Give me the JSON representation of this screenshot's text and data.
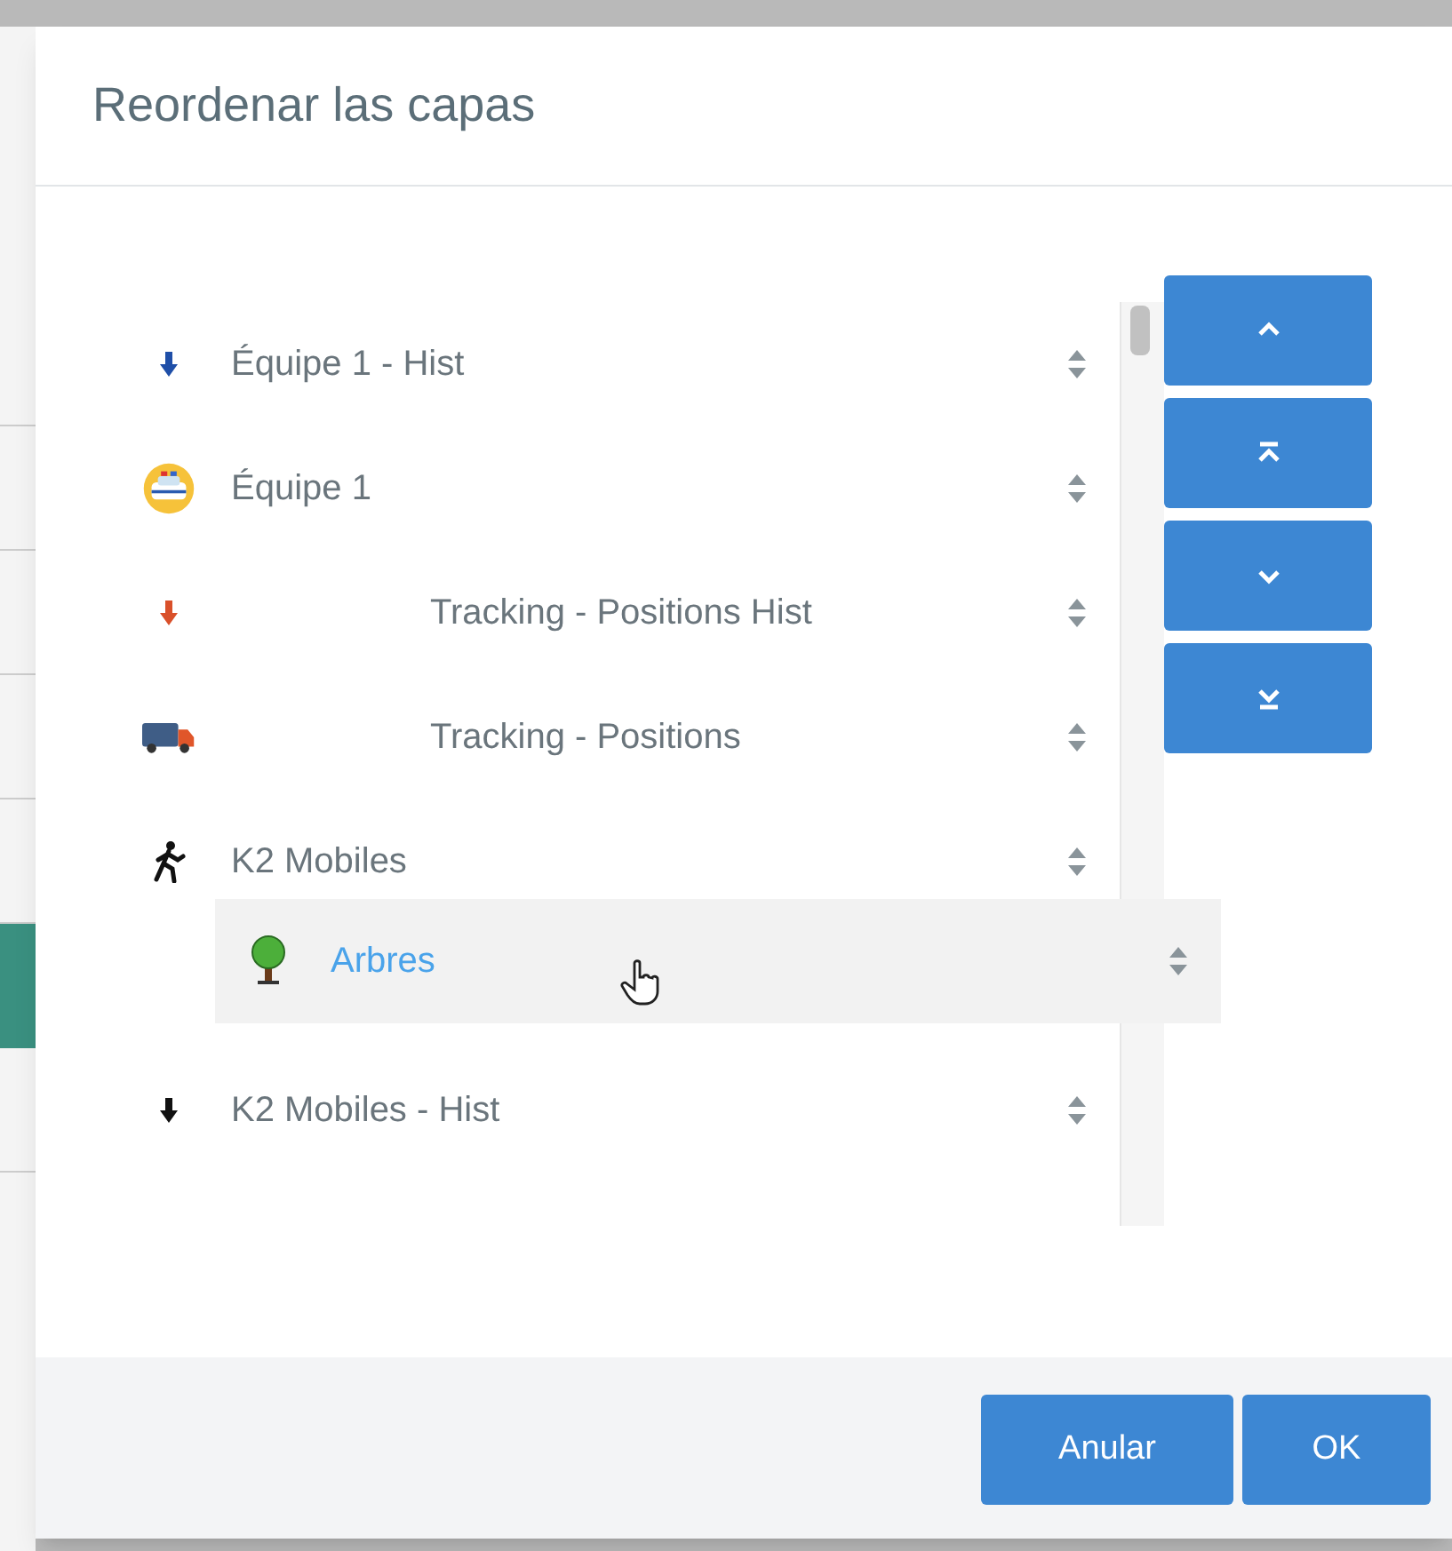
{
  "dialog": {
    "title": "Reordenar las capas"
  },
  "layers": [
    {
      "label": "Équipe 1 - Hist",
      "kind": "arrow",
      "color": "#1f4fa8",
      "text_indented": false,
      "dragging": false
    },
    {
      "label": "Équipe 1",
      "kind": "police-car",
      "text_indented": false,
      "dragging": false
    },
    {
      "label": "Tracking - Positions Hist",
      "kind": "arrow",
      "color": "#d9502a",
      "text_indented": true,
      "dragging": false
    },
    {
      "label": "Tracking - Positions",
      "kind": "truck",
      "text_indented": true,
      "dragging": false
    },
    {
      "label": "K2 Mobiles",
      "kind": "runner",
      "text_indented": false,
      "dragging": false
    },
    {
      "label": "Arbres",
      "kind": "tree",
      "text_indented": false,
      "dragging": true
    },
    {
      "label": "K2 Mobiles - Hist",
      "kind": "arrow",
      "color": "#111111",
      "text_indented": false,
      "dragging": false
    }
  ],
  "move_buttons": [
    {
      "kind": "up"
    },
    {
      "kind": "top"
    },
    {
      "kind": "down"
    },
    {
      "kind": "bottom"
    }
  ],
  "footer_buttons": [
    {
      "label": "Anular"
    },
    {
      "label": "OK"
    }
  ]
}
